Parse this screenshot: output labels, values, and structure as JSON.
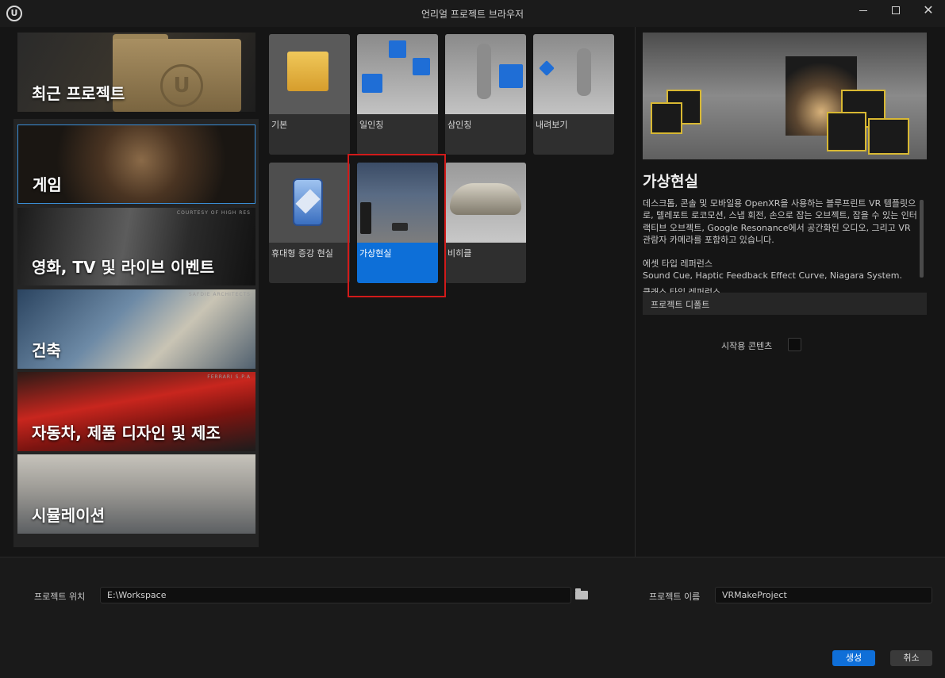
{
  "window": {
    "title": "언리얼 프로젝트 브라우저",
    "logo": "ue-logo-icon",
    "controls": [
      "minimize-icon",
      "maximize-icon",
      "close-icon"
    ]
  },
  "categories": [
    {
      "label": "최근 프로젝트",
      "credit": ""
    },
    {
      "label": "게임",
      "credit": ""
    },
    {
      "label": "영화, TV 및 라이브 이벤트",
      "credit": "COURTESY OF HIGH RES"
    },
    {
      "label": "건축",
      "credit": "SAFDIE ARCHITECTS"
    },
    {
      "label": "자동차, 제품 디자인 및 제조",
      "credit": "FERRARI S.P.A"
    },
    {
      "label": "시뮬레이션",
      "credit": ""
    }
  ],
  "selected_category": "게임",
  "templates": [
    {
      "label": "기본"
    },
    {
      "label": "일인칭"
    },
    {
      "label": "삼인칭"
    },
    {
      "label": "내려보기"
    },
    {
      "label": "휴대형 증강 현실"
    },
    {
      "label": "가상현실"
    },
    {
      "label": "비히클"
    }
  ],
  "selected_template": "가상현실",
  "preview": {
    "title": "가상현실",
    "description": "데스크톱, 콘솔 및 모바일용 OpenXR을 사용하는 블루프린트 VR 템플릿으로, 텔레포트 로코모션, 스냅 회전, 손으로 잡는 오브젝트, 잡을 수 있는 인터랙티브 오브젝트, Google Resonance에서 공간화된 오디오, 그리고 VR 관람자 카메라를 포함하고 있습니다.",
    "asset_ref_title": "에셋 타입 레퍼런스",
    "asset_ref": "Sound Cue, Haptic Feedback Effect Curve, Niagara System.",
    "cut_line": "클래스 타입 레퍼런스",
    "section": "프로젝트 디폴트",
    "starter_content_label": "시작용 콘텐츠",
    "starter_content_checked": false
  },
  "project": {
    "location_label": "프로젝트 위치",
    "location_value": "E:\\Workspace",
    "name_label": "프로젝트 이름",
    "name_value": "VRMakeProject"
  },
  "buttons": {
    "create": "생성",
    "cancel": "취소"
  },
  "colors": {
    "accent": "#0f6fd8",
    "highlight": "#d11a1a"
  }
}
